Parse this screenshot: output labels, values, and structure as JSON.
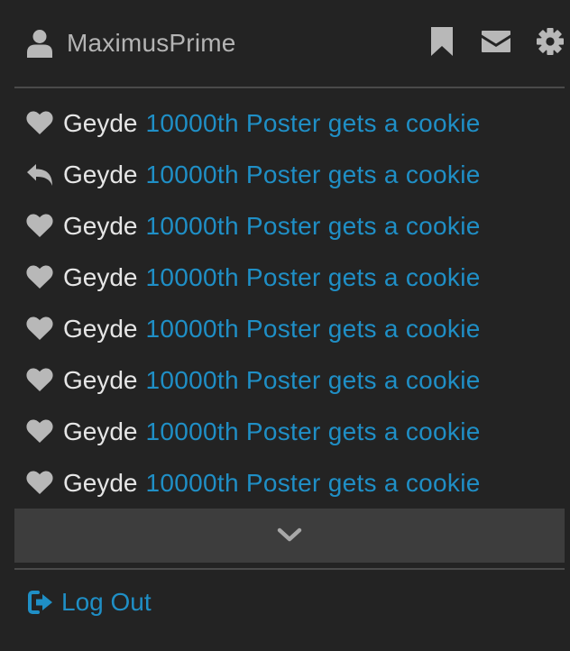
{
  "colors": {
    "background": "#232323",
    "link": "#1f8fc6",
    "username": "#b4b4b4",
    "text": "#e6e6e6",
    "icon": "#b8b8b8",
    "more_bar": "#3d3d3d"
  },
  "header": {
    "username": "MaximusPrime",
    "user_icon": "user-icon",
    "icons": [
      "bookmark-icon",
      "envelope-icon",
      "gear-icon"
    ]
  },
  "alerts": [
    {
      "icon": "heart-icon",
      "user": "Geyde",
      "link": "10000th Poster gets a cookie"
    },
    {
      "icon": "reply-icon",
      "user": "Geyde",
      "link": "10000th Poster gets a cookie"
    },
    {
      "icon": "heart-icon",
      "user": "Geyde",
      "link": "10000th Poster gets a cookie"
    },
    {
      "icon": "heart-icon",
      "user": "Geyde",
      "link": "10000th Poster gets a cookie"
    },
    {
      "icon": "heart-icon",
      "user": "Geyde",
      "link": "10000th Poster gets a cookie"
    },
    {
      "icon": "heart-icon",
      "user": "Geyde",
      "link": "10000th Poster gets a cookie"
    },
    {
      "icon": "heart-icon",
      "user": "Geyde",
      "link": "10000th Poster gets a cookie"
    },
    {
      "icon": "heart-icon",
      "user": "Geyde",
      "link": "10000th Poster gets a cookie"
    }
  ],
  "more": {
    "icon": "chevron-down-icon"
  },
  "logout": {
    "label": "Log Out",
    "icon": "sign-out-icon"
  }
}
